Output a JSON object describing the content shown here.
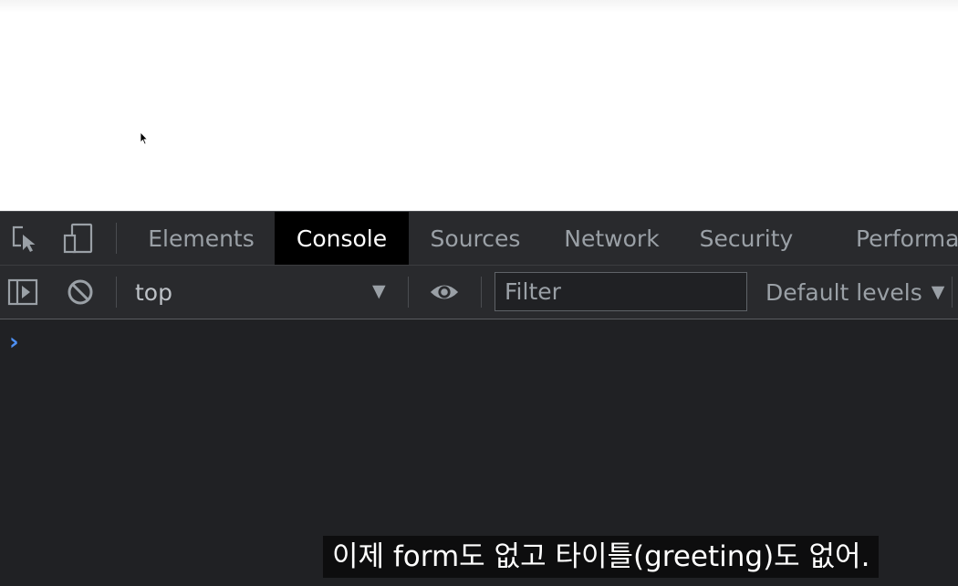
{
  "devtools": {
    "tabs": [
      {
        "label": "Elements"
      },
      {
        "label": "Console",
        "active": true
      },
      {
        "label": "Sources"
      },
      {
        "label": "Network"
      },
      {
        "label": "Security"
      },
      {
        "label": "Performance"
      }
    ],
    "toolbar_icons": [
      "inspect-element-icon",
      "device-toggle-icon"
    ],
    "console_toolbar": {
      "sidebar_toggle_icon": "sidebar-toggle-icon",
      "clear_icon": "clear-console-icon",
      "context": "top",
      "eye_icon": "eye-icon",
      "filter_placeholder": "Filter",
      "levels": "Default levels"
    },
    "prompt_symbol": "›"
  },
  "subtitle": "이제 form도 없고 타이틀(greeting)도 없어.",
  "colors": {
    "panel_bg": "#202124",
    "toolbar_bg": "#292a2d",
    "active_tab_bg": "#000000",
    "tab_text": "#9aa0a6",
    "prompt": "#4d8ff2"
  }
}
